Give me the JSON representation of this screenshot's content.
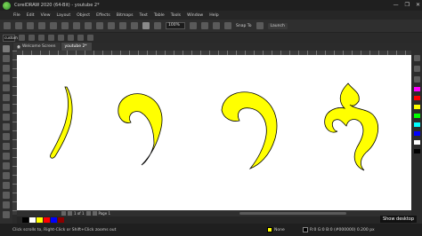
{
  "window": {
    "title": "CorelDRAW 2020 (64-Bit) - youtube 2*",
    "controls": [
      "—",
      "❐",
      "✕"
    ]
  },
  "menu": [
    "File",
    "Edit",
    "View",
    "Layout",
    "Object",
    "Effects",
    "Bitmaps",
    "Text",
    "Table",
    "Tools",
    "Window",
    "Help"
  ],
  "toolbar": {
    "zoom": "100%",
    "snap_to": "Snap To",
    "launch": "Launch"
  },
  "propbar": {
    "size": "custom"
  },
  "doc_tabs": [
    {
      "label": "Welcome Screen",
      "active": false
    },
    {
      "label": "youtube 2*",
      "active": true
    }
  ],
  "page_nav": {
    "position": "1 of 1",
    "page": "Page 1"
  },
  "palette_colors": [
    "#000000",
    "#ffffff",
    "#ffff00",
    "#ff0000",
    "#0000ff",
    "#8b0000"
  ],
  "status": {
    "hint": "Click scrolls to, Right-Click or Shift+Click zooms out",
    "fill": "None",
    "outline": "R:0 G:0 B:0 (#000000) 0.200 px",
    "fill_color": "#ffff00",
    "outline_color": "#000000"
  },
  "overlay": {
    "show_desktop": "Show desktop"
  },
  "canvas": {
    "shape_fill": "#ffff00",
    "shape_stroke": "#000000",
    "glyphs": [
      "glyph-1",
      "glyph-2",
      "glyph-3",
      "glyph-4"
    ]
  }
}
